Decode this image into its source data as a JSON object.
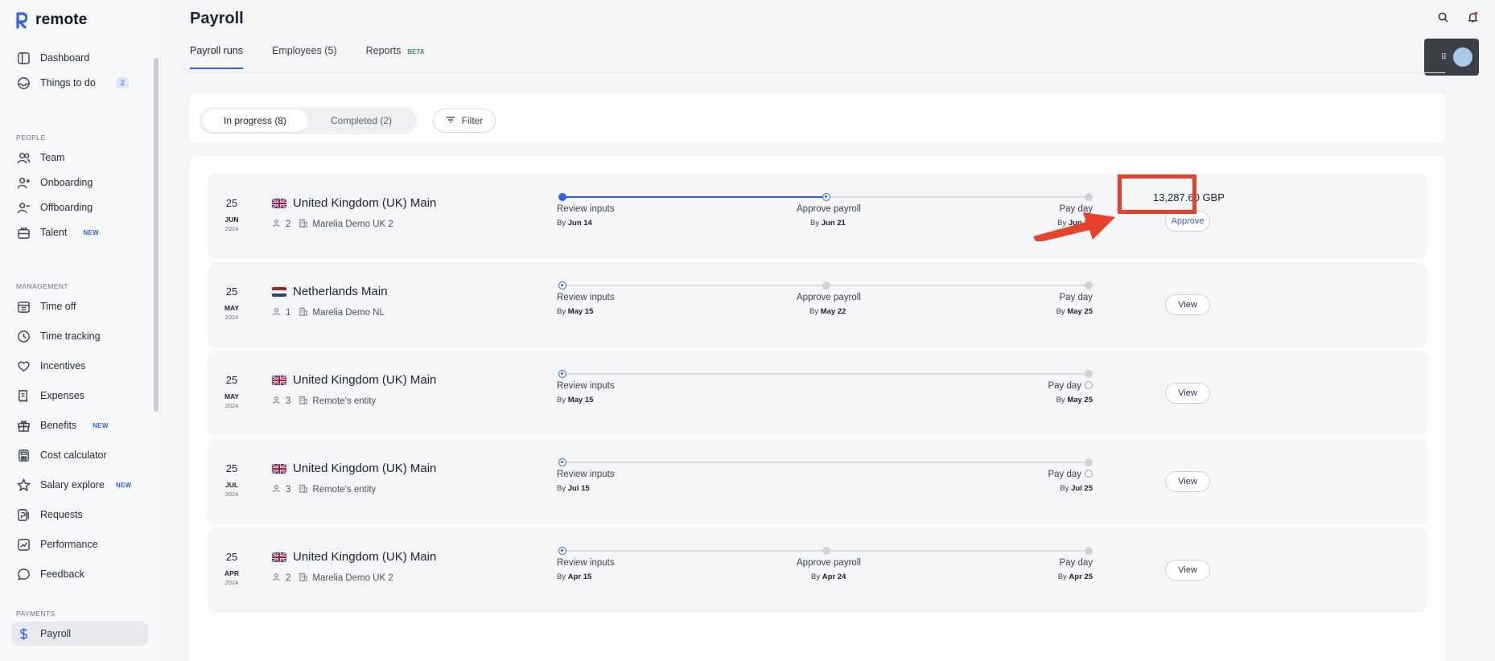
{
  "app": {
    "logo_text": "remote"
  },
  "sidebar": {
    "items_top": [
      {
        "label": "Dashboard",
        "icon": "dashboard-icon"
      },
      {
        "label": "Things to do",
        "icon": "inbox-icon",
        "badge": "2"
      }
    ],
    "sections": [
      {
        "title": "PEOPLE",
        "items": [
          {
            "label": "Team",
            "icon": "team-icon"
          },
          {
            "label": "Onboarding",
            "icon": "user-plus-icon"
          },
          {
            "label": "Offboarding",
            "icon": "user-minus-icon"
          },
          {
            "label": "Talent",
            "icon": "briefcase-icon",
            "tag": "NEW"
          }
        ]
      },
      {
        "title": "MANAGEMENT",
        "items": [
          {
            "label": "Time off",
            "icon": "calendar-icon"
          },
          {
            "label": "Time tracking",
            "icon": "clock-icon"
          },
          {
            "label": "Incentives",
            "icon": "heart-icon"
          },
          {
            "label": "Expenses",
            "icon": "receipt-icon"
          },
          {
            "label": "Benefits",
            "icon": "gift-icon",
            "tag": "NEW"
          },
          {
            "label": "Cost calculator",
            "icon": "calculator-icon"
          },
          {
            "label": "Salary explore",
            "icon": "star-icon",
            "tag": "NEW"
          },
          {
            "label": "Requests",
            "icon": "request-icon"
          },
          {
            "label": "Performance",
            "icon": "chart-icon"
          },
          {
            "label": "Feedback",
            "icon": "speech-bubble-icon"
          }
        ]
      },
      {
        "title": "PAYMENTS",
        "items": [
          {
            "label": "Payroll",
            "icon": "dollar-icon",
            "active": true
          }
        ]
      }
    ]
  },
  "header": {
    "title": "Payroll",
    "tabs": [
      {
        "label": "Payroll runs",
        "active": true
      },
      {
        "label": "Employees (5)"
      },
      {
        "label": "Reports",
        "tag": "BETA"
      }
    ]
  },
  "filters": {
    "segments": [
      "In progress (8)",
      "Completed (2)"
    ],
    "filter_label": "Filter"
  },
  "runs": [
    {
      "day": "25",
      "month": "JUN",
      "year": "2024",
      "name": "United Kingdom (UK) Main",
      "flag": "uk",
      "employees": "2",
      "entity": "Marelia Demo UK 2",
      "steps": [
        {
          "label": "Review inputs",
          "by": "By",
          "date": "Jun 14"
        },
        {
          "label": "Approve payroll",
          "by": "By",
          "date": "Jun 21"
        },
        {
          "label": "Pay day",
          "by": "By",
          "date": "Jun 25"
        }
      ],
      "amount": "13,287.60 GBP",
      "action": "Approve"
    },
    {
      "day": "25",
      "month": "MAY",
      "year": "2024",
      "name": "Netherlands Main",
      "flag": "nl",
      "employees": "1",
      "entity": "Marelia Demo NL",
      "steps": [
        {
          "label": "Review inputs",
          "by": "By",
          "date": "May 15"
        },
        {
          "label": "Approve payroll",
          "by": "By",
          "date": "May 22"
        },
        {
          "label": "Pay day",
          "by": "By",
          "date": "May 25"
        }
      ],
      "action": "View"
    },
    {
      "day": "25",
      "month": "MAY",
      "year": "2024",
      "name": "United Kingdom (UK) Main",
      "flag": "uk",
      "employees": "3",
      "entity": "Remote's entity",
      "steps": [
        {
          "label": "Review inputs",
          "by": "By",
          "date": "May 15"
        },
        {
          "label": "Pay day",
          "by": "By",
          "date": "May 25"
        }
      ],
      "action": "View"
    },
    {
      "day": "25",
      "month": "JUL",
      "year": "2024",
      "name": "United Kingdom (UK) Main",
      "flag": "uk",
      "employees": "3",
      "entity": "Remote's entity",
      "steps": [
        {
          "label": "Review inputs",
          "by": "By",
          "date": "Jul 15"
        },
        {
          "label": "Pay day",
          "by": "By",
          "date": "Jul 25"
        }
      ],
      "action": "View"
    },
    {
      "day": "25",
      "month": "APR",
      "year": "2024",
      "name": "United Kingdom (UK) Main",
      "flag": "uk",
      "employees": "2",
      "entity": "Marelia Demo UK 2",
      "steps": [
        {
          "label": "Review inputs",
          "by": "By",
          "date": "Apr 15"
        },
        {
          "label": "Approve payroll",
          "by": "By",
          "date": "Apr 24"
        },
        {
          "label": "Pay day",
          "by": "By",
          "date": "Apr 25"
        }
      ],
      "action": "View"
    }
  ],
  "colors": {
    "accent": "#2f62e8",
    "annotation": "#e8412a"
  }
}
